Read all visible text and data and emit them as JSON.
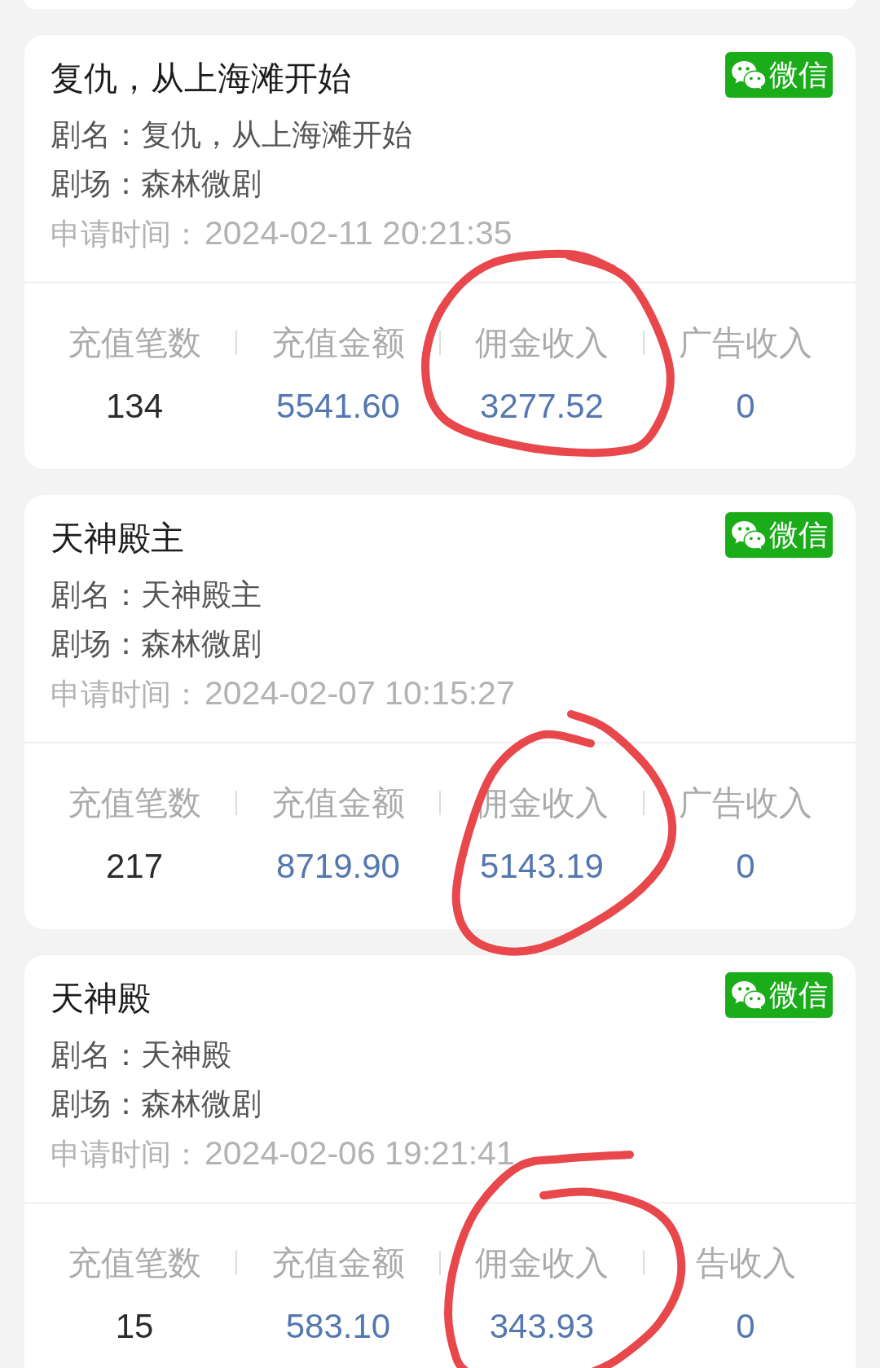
{
  "cards": [
    {
      "title": "复仇，从上海滩开始",
      "platform": "微信",
      "fields": [
        {
          "label": "剧名：",
          "value": "复仇，从上海滩开始",
          "muted": false
        },
        {
          "label": "剧场：",
          "value": "森林微剧",
          "muted": false
        },
        {
          "label": "申请时间：",
          "value": "2024-02-11 20:21:35",
          "muted": true
        }
      ],
      "stats": [
        {
          "kind": "count",
          "label": "充值笔数",
          "value": "134",
          "circled": false
        },
        {
          "kind": "amount",
          "label": "充值金额",
          "value": "5541.60",
          "circled": false
        },
        {
          "kind": "amount",
          "label": "佣金收入",
          "value": "3277.52",
          "circled": true
        },
        {
          "kind": "amount",
          "label": "广告收入",
          "value": "0",
          "circled": false
        }
      ]
    },
    {
      "title": "天神殿主",
      "platform": "微信",
      "fields": [
        {
          "label": "剧名：",
          "value": "天神殿主",
          "muted": false
        },
        {
          "label": "剧场：",
          "value": "森林微剧",
          "muted": false
        },
        {
          "label": "申请时间：",
          "value": "2024-02-07 10:15:27",
          "muted": true
        }
      ],
      "stats": [
        {
          "kind": "count",
          "label": "充值笔数",
          "value": "217",
          "circled": false
        },
        {
          "kind": "amount",
          "label": "充值金额",
          "value": "8719.90",
          "circled": false
        },
        {
          "kind": "amount",
          "label": "佣金收入",
          "value": "5143.19",
          "circled": true
        },
        {
          "kind": "amount",
          "label": "广告收入",
          "value": "0",
          "circled": false
        }
      ]
    },
    {
      "title": "天神殿",
      "platform": "微信",
      "fields": [
        {
          "label": "剧名：",
          "value": "天神殿",
          "muted": false
        },
        {
          "label": "剧场：",
          "value": "森林微剧",
          "muted": false
        },
        {
          "label": "申请时间：",
          "value": "2024-02-06 19:21:41",
          "muted": true
        }
      ],
      "stats": [
        {
          "kind": "count",
          "label": "充值笔数",
          "value": "15",
          "circled": false
        },
        {
          "kind": "amount",
          "label": "充值金额",
          "value": "583.10",
          "circled": false
        },
        {
          "kind": "amount",
          "label": "佣金收入",
          "value": "343.93",
          "circled": true
        },
        {
          "kind": "amount",
          "label": "告收入",
          "value": "0",
          "circled": false
        }
      ]
    }
  ]
}
